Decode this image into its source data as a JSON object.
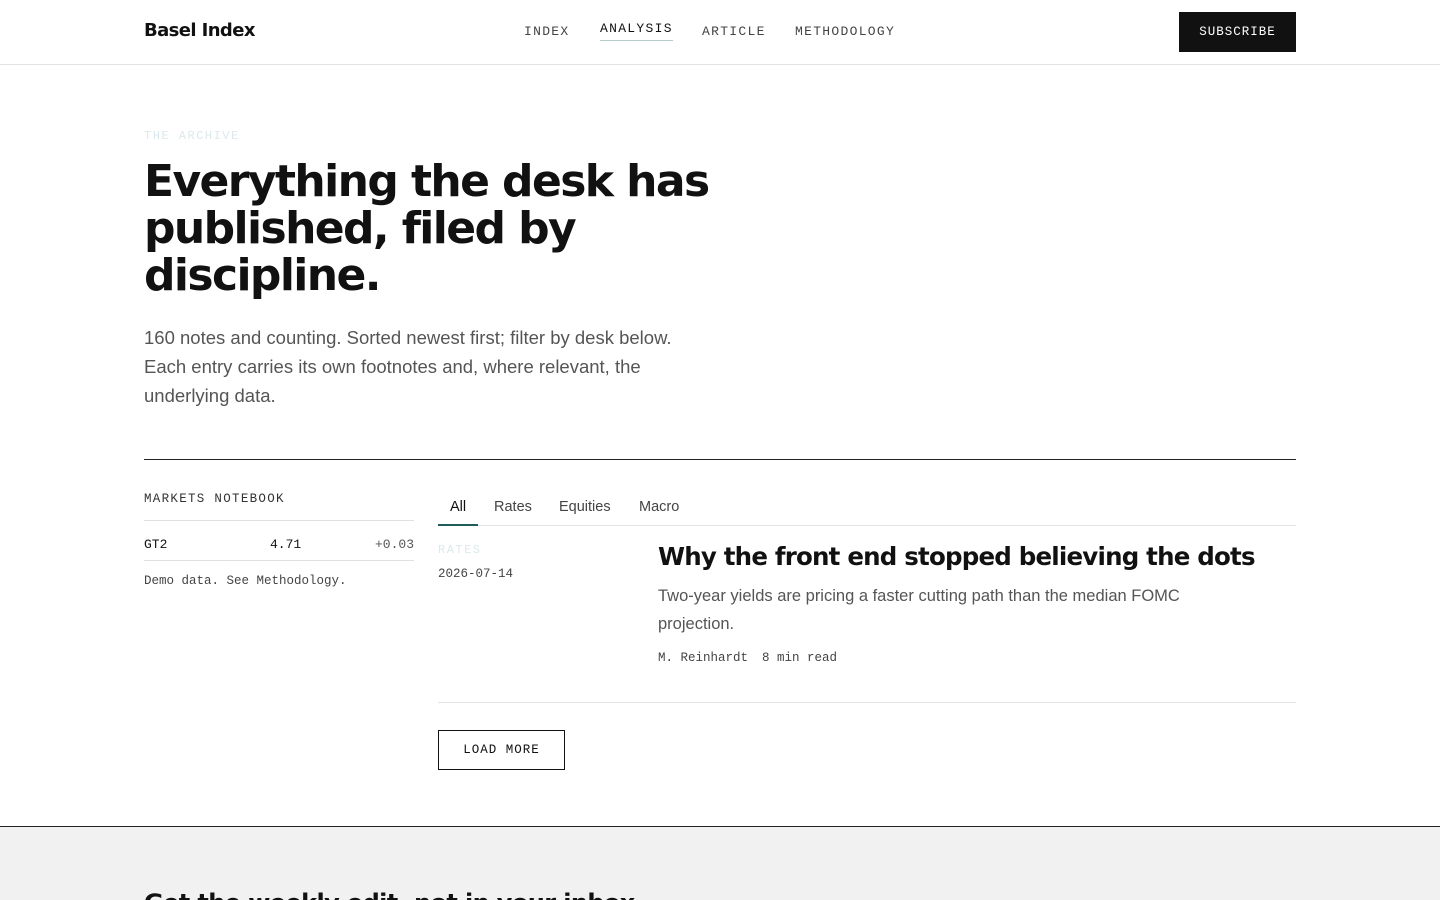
{
  "header": {
    "logo": "Basel Index",
    "nav": [
      "INDEX",
      "ANALYSIS",
      "ARTICLE",
      "METHODOLOGY"
    ],
    "active_nav": "ANALYSIS",
    "subscribe_label": "SUBSCRIBE"
  },
  "hero": {
    "eyebrow": "THE ARCHIVE",
    "title": "Everything the desk has published, filed by discipline.",
    "lede": "160 notes and counting. Sorted newest first; filter by desk below. Each entry carries its own footnotes and, where relevant, the underlying data."
  },
  "sidebar": {
    "title": "MARKETS NOTEBOOK",
    "tickers": [
      {
        "symbol": "GT2",
        "value": "4.71",
        "change": "+0.03"
      }
    ],
    "note": "Demo data. See Methodology."
  },
  "tabs": {
    "items": [
      "All",
      "Rates",
      "Equities",
      "Macro"
    ],
    "active": "All"
  },
  "articles": [
    {
      "category": "RATES",
      "date": "2026-07-14",
      "title": "Why the front end stopped believing the dots",
      "dek": "Two-year yields are pricing a faster cutting path than the median FOMC projection.",
      "author": "M. Reinhardt",
      "read_time": "8 min read"
    }
  ],
  "load_more_label": "LOAD MORE",
  "band": {
    "title": "Get the weekly edit, not in your inbox"
  },
  "colors": {
    "accent": "#1d5c58",
    "ink": "#111111",
    "muted": "#555555",
    "eyebrow": "#dce9ec",
    "band_bg": "#f1f1f1"
  }
}
